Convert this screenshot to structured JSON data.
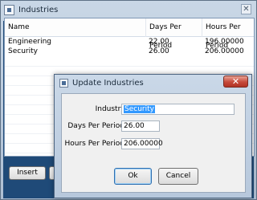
{
  "main_window": {
    "title": "Industries",
    "close_glyph": "✕",
    "grid": {
      "columns": [
        "Name",
        "Days Per Period",
        "Hours Per Period"
      ],
      "rows": [
        {
          "name": "Engineering",
          "days": "22.00",
          "hours": "196.00000"
        },
        {
          "name": "Security",
          "days": "26.00",
          "hours": "206.00000"
        }
      ]
    },
    "insert_label": "Insert"
  },
  "dialog": {
    "title": "Update Industries",
    "close_glyph": "✕",
    "industry_label": "Industry:",
    "industry_value": "Security",
    "days_label": "Days Per Period:",
    "days_value": "26.00",
    "hours_label": "Hours Per Period:",
    "hours_value": "206.00000",
    "ok_label": "Ok",
    "cancel_label": "Cancel"
  },
  "colors": {
    "client_background": "#1f4a78",
    "close_button": "#c6493a",
    "selection": "#3399ff"
  }
}
